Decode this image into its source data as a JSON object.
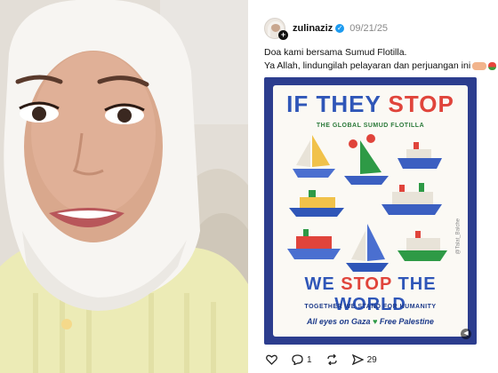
{
  "post": {
    "username": "zulinaziz",
    "date": "09/21/25",
    "caption_line1": "Doa kami bersama Sumud Flotilla.",
    "caption_line2": "Ya Allah, lindungilah pelayaran dan perjuangan ini"
  },
  "poster": {
    "headline_a": "IF THEY ",
    "headline_b": "STOP",
    "subtitle": "THE GLOBAL SUMUD FLOTILLA",
    "headline2_a": "WE ",
    "headline2_b": "STOP ",
    "headline2_c": "THE WORLD",
    "tagline": "TOGETHER WE STAND FOR HUMANITY",
    "footer_a": "All eyes on Gaza ",
    "footer_b": " Free Palestine",
    "signature": "@Talat_Balche"
  },
  "actions": {
    "comments": "1",
    "shares": "29"
  },
  "colors": {
    "poster_bg": "#2c3d8e",
    "headline_blue": "#2f56b8",
    "headline_red": "#e0443b",
    "verified": "#1d9bf0"
  },
  "icons": [
    "heart-icon",
    "comment-icon",
    "repost-icon",
    "send-icon",
    "mute-icon",
    "verified-icon"
  ]
}
